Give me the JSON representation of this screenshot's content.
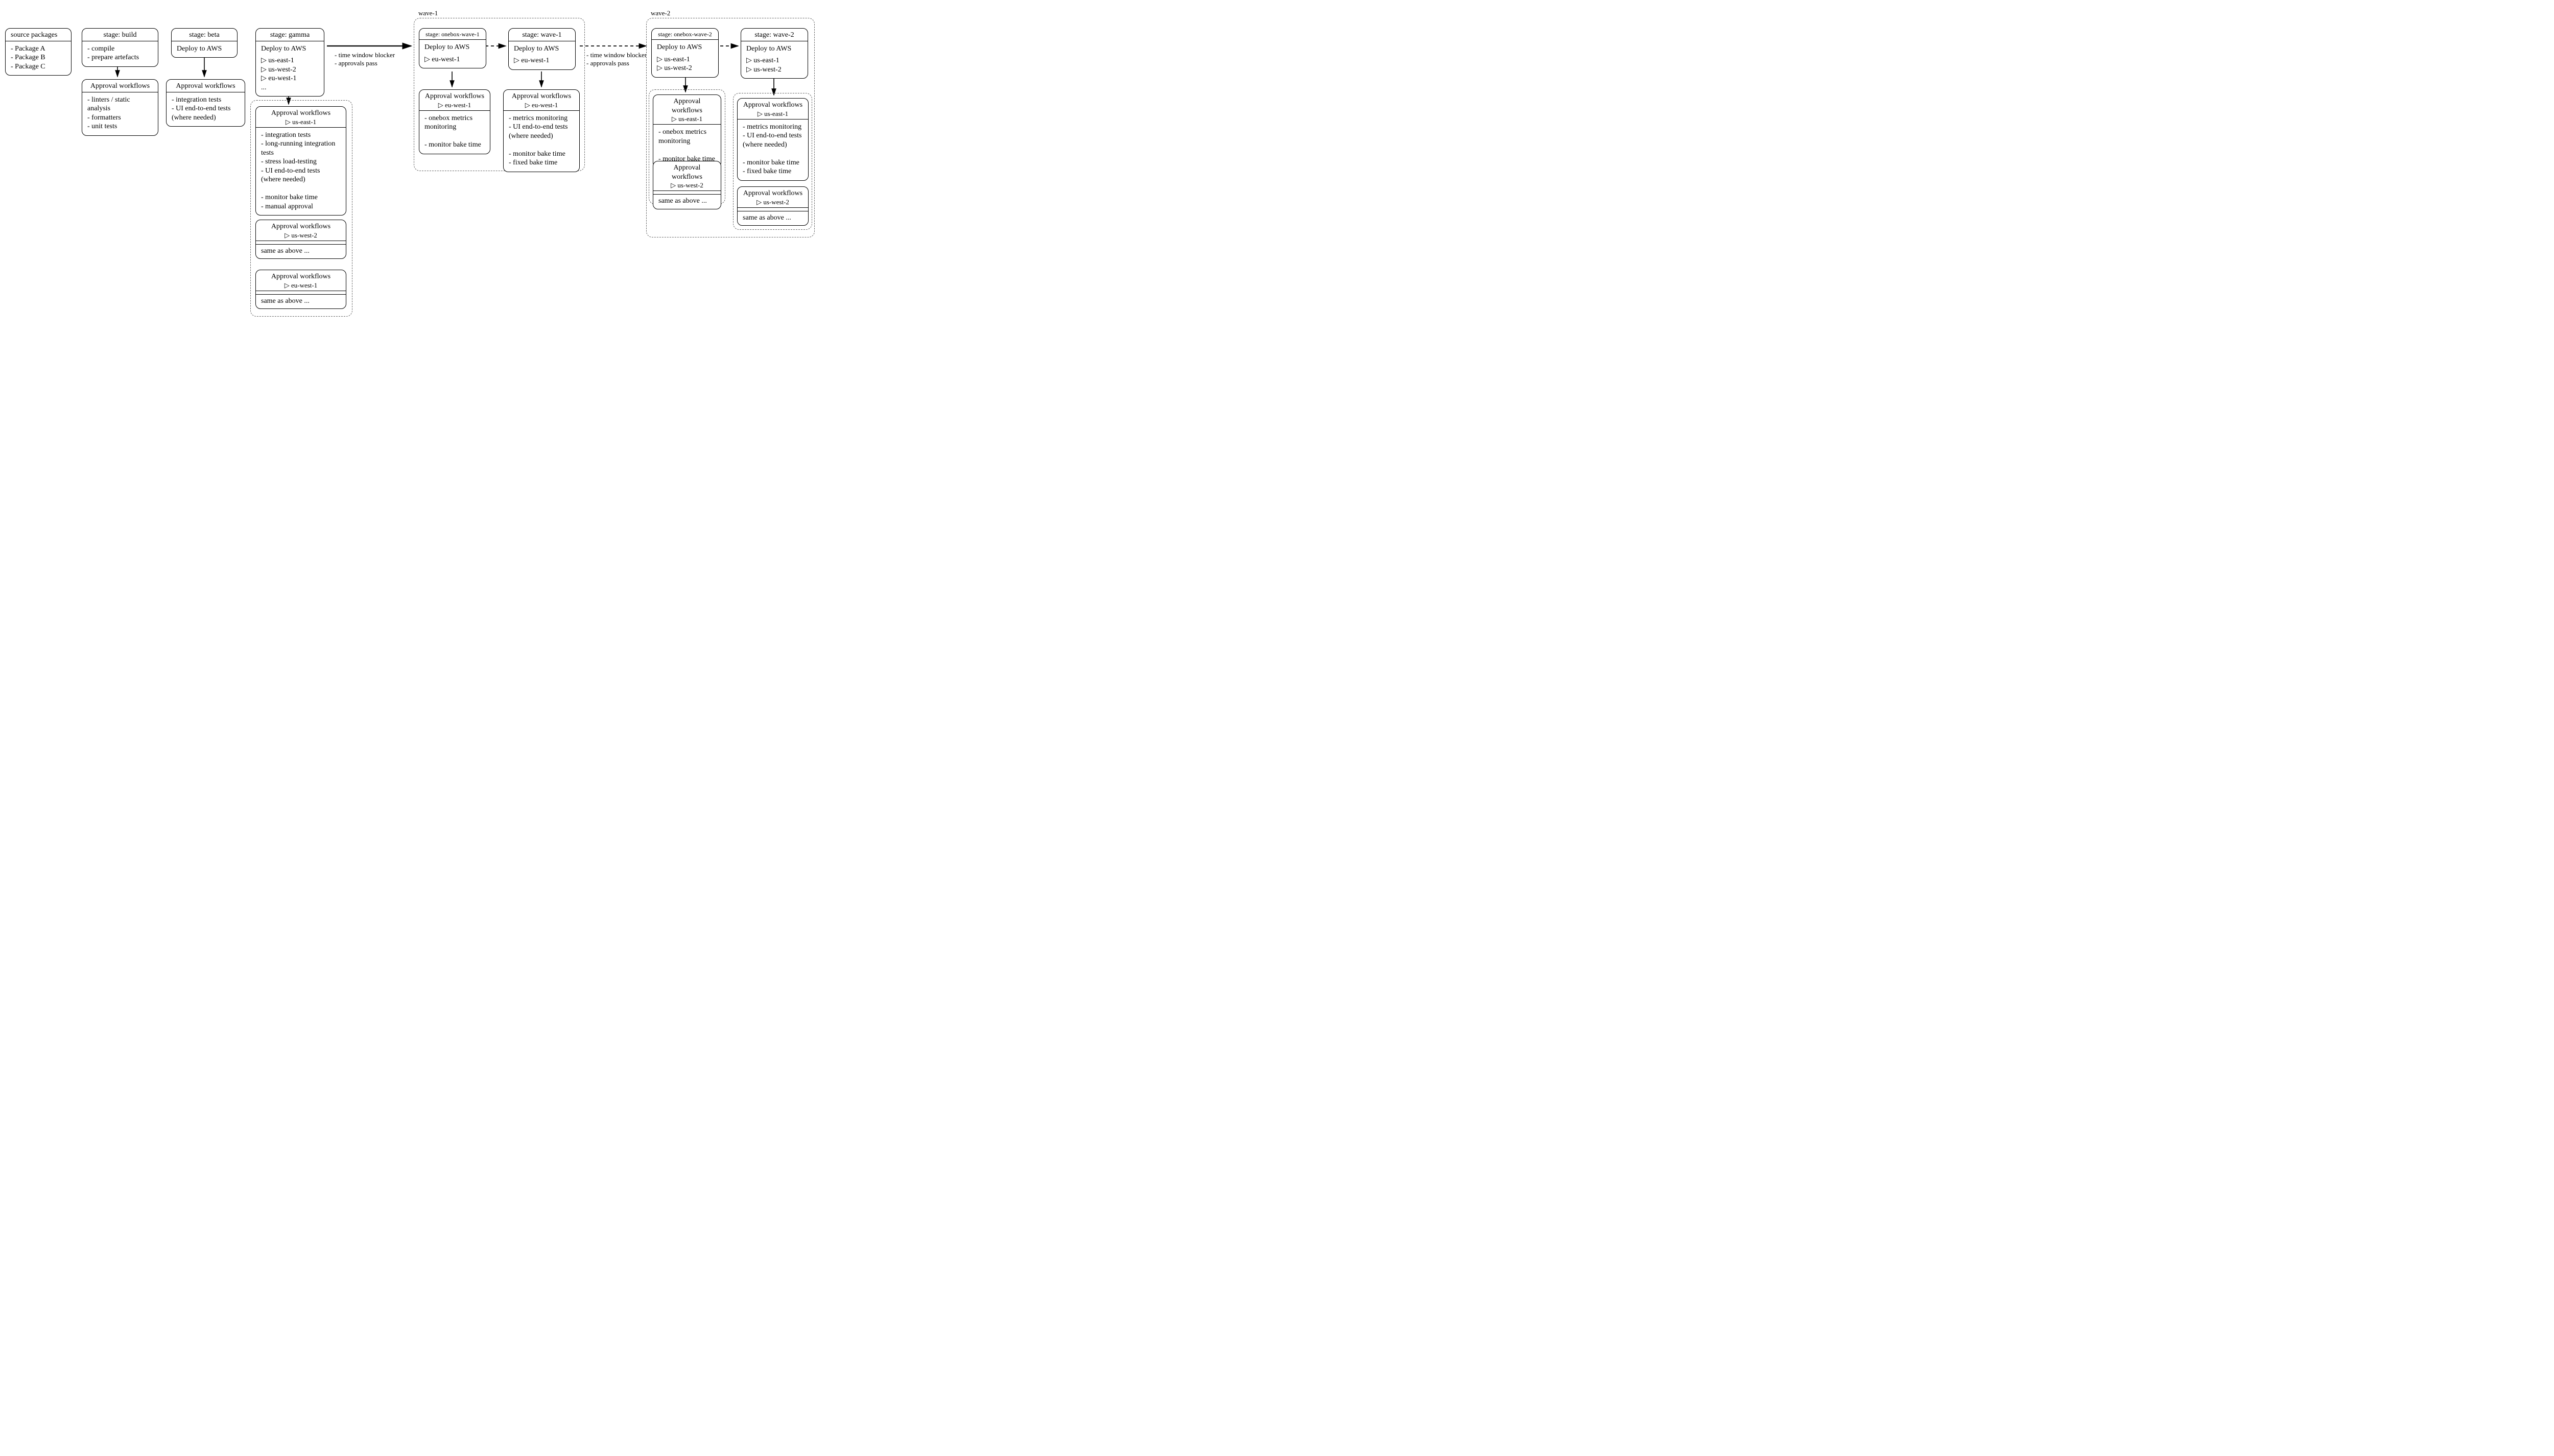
{
  "source": {
    "title": "source packages",
    "items": [
      "- Package A",
      "- Package B",
      "- Package C"
    ]
  },
  "build": {
    "title": "stage: build",
    "items": [
      "- compile",
      "- prepare artefacts"
    ]
  },
  "build_approval": {
    "title": "Approval workflows",
    "items": [
      "- linters / static analysis",
      "- formatters",
      "- unit tests"
    ]
  },
  "beta": {
    "title": "stage: beta",
    "body": "Deploy to AWS"
  },
  "beta_approval": {
    "title": "Approval workflows",
    "items": [
      "- integration tests",
      "- UI end-to-end tests (where needed)"
    ]
  },
  "gamma": {
    "title": "stage: gamma",
    "body": "Deploy to AWS",
    "regions": [
      "▷ us-east-1",
      "▷ us-west-2",
      "▷ eu-west-1",
      "..."
    ]
  },
  "gamma_group_label": "",
  "gamma_a1": {
    "title": "Approval workflows",
    "sub": "▷ us-east-1",
    "items": [
      "- integration tests",
      "- long-running integration tests",
      "- stress load-testing",
      "- UI end-to-end tests (where needed)",
      "",
      "- monitor bake time",
      "- manual approval"
    ]
  },
  "gamma_a2": {
    "title": "Approval workflows",
    "sub": "▷ us-west-2",
    "same": "same as above ..."
  },
  "gamma_a3": {
    "title": "Approval workflows",
    "sub": "▷ eu-west-1",
    "same": "same as above ..."
  },
  "note1": {
    "l1": "- time window blocker",
    "l2": "- approvals pass"
  },
  "wave1_label": "wave-1",
  "onebox1": {
    "title": "stage: onebox-wave-1",
    "body": "Deploy to AWS",
    "regions": [
      "▷ eu-west-1"
    ]
  },
  "onebox1_a": {
    "title": "Approval workflows",
    "sub": "▷ eu-west-1",
    "items": [
      "- onebox metrics monitoring",
      "",
      "- monitor bake time"
    ]
  },
  "wave1": {
    "title": "stage: wave-1",
    "body": "Deploy to AWS",
    "regions": [
      "▷ eu-west-1"
    ]
  },
  "wave1_a": {
    "title": "Approval workflows",
    "sub": "▷ eu-west-1",
    "items": [
      "- metrics monitoring",
      "- UI end-to-end tests (where needed)",
      "",
      "- monitor bake time",
      "- fixed bake time"
    ]
  },
  "note2": {
    "l1": "- time window blocker",
    "l2": "- approvals pass"
  },
  "wave2_label": "wave-2",
  "onebox2": {
    "title": "stage: onebox-wave-2",
    "body": "Deploy to AWS",
    "regions": [
      "▷ us-east-1",
      "▷ us-west-2"
    ]
  },
  "onebox2_a1": {
    "title": "Approval workflows",
    "sub": "▷ us-east-1",
    "items": [
      "- onebox metrics monitoring",
      "",
      "- monitor bake time"
    ]
  },
  "onebox2_a2": {
    "title": "Approval workflows",
    "sub": "▷ us-west-2",
    "same": "same as above ..."
  },
  "wave2": {
    "title": "stage: wave-2",
    "body": "Deploy to AWS",
    "regions": [
      "▷ us-east-1",
      "▷ us-west-2"
    ]
  },
  "wave2_a1": {
    "title": "Approval workflows",
    "sub": "▷ us-east-1",
    "items": [
      "- metrics monitoring",
      "- UI end-to-end tests (where needed)",
      "",
      "- monitor bake time",
      "- fixed bake time"
    ]
  },
  "wave2_a2": {
    "title": "Approval workflows",
    "sub": "▷ us-west-2",
    "same": "same as above ..."
  },
  "chart_data": {
    "type": "pipeline",
    "stages": [
      {
        "name": "source packages",
        "packages": [
          "Package A",
          "Package B",
          "Package C"
        ]
      },
      {
        "name": "build",
        "steps": [
          "compile",
          "prepare artefacts"
        ],
        "approval": [
          "linters / static analysis",
          "formatters",
          "unit tests"
        ]
      },
      {
        "name": "beta",
        "deploy": "AWS",
        "approval": [
          "integration tests",
          "UI end-to-end tests (where needed)"
        ]
      },
      {
        "name": "gamma",
        "deploy": "AWS",
        "regions": [
          "us-east-1",
          "us-west-2",
          "eu-west-1",
          "..."
        ],
        "approval_per_region": {
          "us-east-1": [
            "integration tests",
            "long-running integration tests",
            "stress load-testing",
            "UI end-to-end tests (where needed)",
            "monitor bake time",
            "manual approval"
          ],
          "us-west-2": "same as above",
          "eu-west-1": "same as above"
        }
      },
      {
        "name": "wave-1",
        "gates": [
          "time window blocker",
          "approvals pass"
        ],
        "substages": [
          {
            "name": "onebox-wave-1",
            "deploy": "AWS",
            "regions": [
              "eu-west-1"
            ],
            "approval": {
              "eu-west-1": [
                "onebox metrics monitoring",
                "monitor bake time"
              ]
            }
          },
          {
            "name": "wave-1",
            "deploy": "AWS",
            "regions": [
              "eu-west-1"
            ],
            "approval": {
              "eu-west-1": [
                "metrics monitoring",
                "UI end-to-end tests (where needed)",
                "monitor bake time",
                "fixed bake time"
              ]
            }
          }
        ]
      },
      {
        "name": "wave-2",
        "gates": [
          "time window blocker",
          "approvals pass"
        ],
        "substages": [
          {
            "name": "onebox-wave-2",
            "deploy": "AWS",
            "regions": [
              "us-east-1",
              "us-west-2"
            ],
            "approval": {
              "us-east-1": [
                "onebox metrics monitoring",
                "monitor bake time"
              ],
              "us-west-2": "same as above"
            }
          },
          {
            "name": "wave-2",
            "deploy": "AWS",
            "regions": [
              "us-east-1",
              "us-west-2"
            ],
            "approval": {
              "us-east-1": [
                "metrics monitoring",
                "UI end-to-end tests (where needed)",
                "monitor bake time",
                "fixed bake time"
              ],
              "us-west-2": "same as above"
            }
          }
        ]
      }
    ]
  }
}
